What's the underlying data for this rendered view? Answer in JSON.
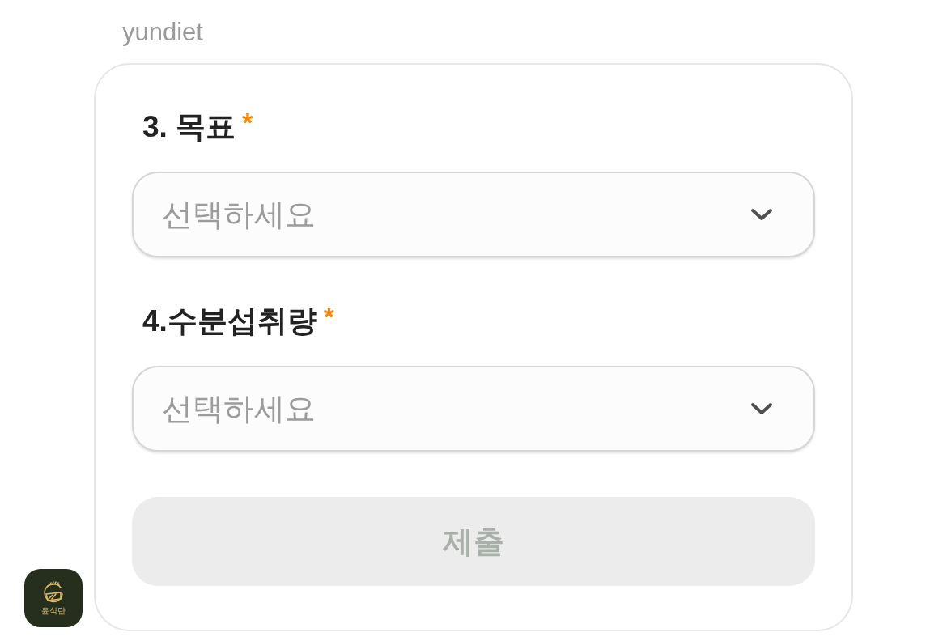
{
  "brand": {
    "name": "yundiet"
  },
  "form": {
    "questions": [
      {
        "label": "3. 목표",
        "required": true,
        "required_mark": "*",
        "select": {
          "placeholder": "선택하세요"
        }
      },
      {
        "label": "4.수분섭취량",
        "required": true,
        "required_mark": "*",
        "select": {
          "placeholder": "선택하세요"
        }
      }
    ],
    "submit": {
      "label": "제출",
      "disabled": true
    }
  },
  "logo": {
    "text": "윤식단"
  }
}
